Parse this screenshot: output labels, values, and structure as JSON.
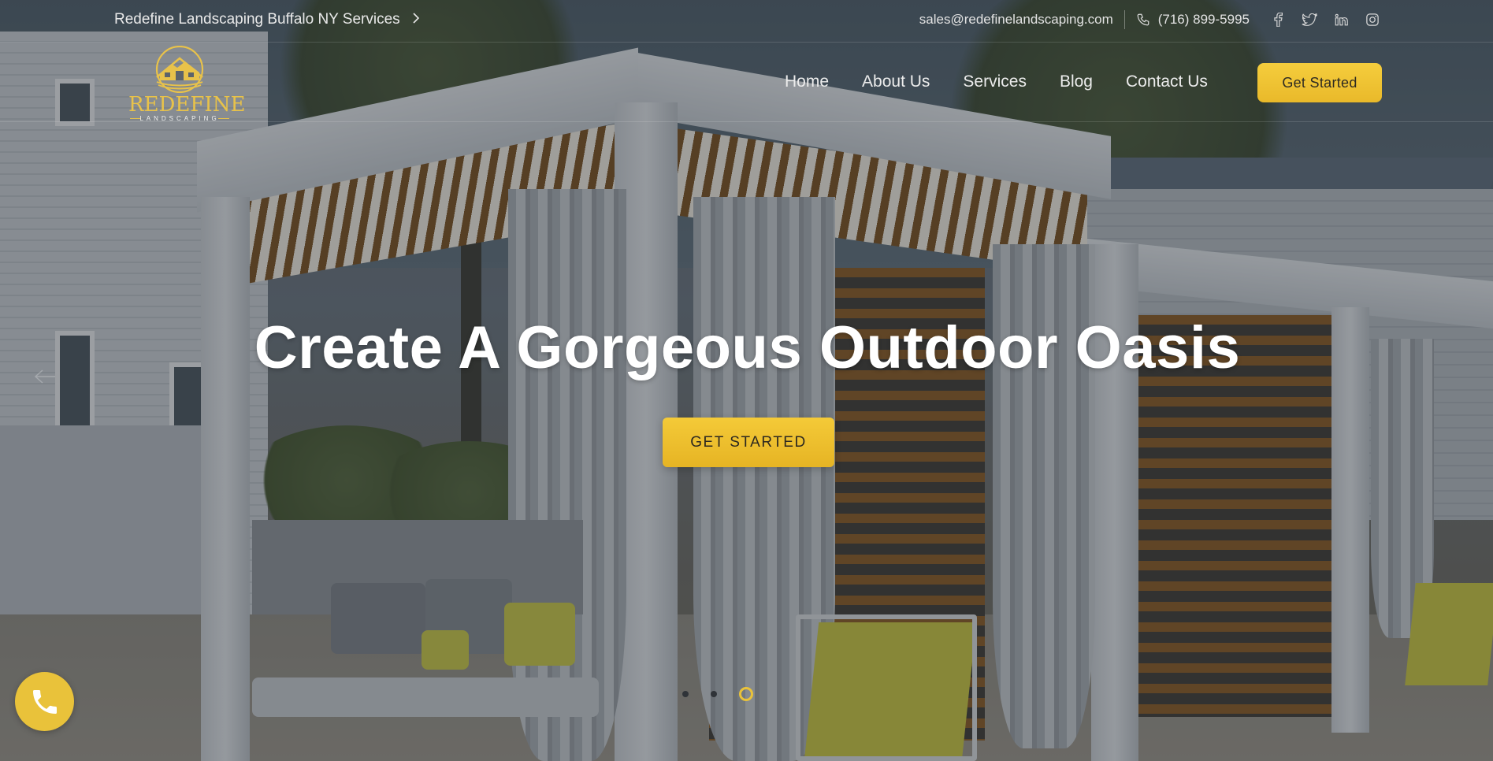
{
  "topbar": {
    "services_link": "Redefine Landscaping Buffalo NY Services",
    "email": "sales@redefinelandscaping.com",
    "phone": "(716) 899-5995",
    "socials": [
      "facebook-icon",
      "twitter-icon",
      "linkedin-icon",
      "instagram-icon"
    ]
  },
  "logo": {
    "name": "REDEFINE",
    "tagline": "LANDSCAPING"
  },
  "nav": {
    "items": [
      {
        "label": "Home"
      },
      {
        "label": "About Us"
      },
      {
        "label": "Services"
      },
      {
        "label": "Blog"
      },
      {
        "label": "Contact Us"
      }
    ],
    "cta_label": "Get Started"
  },
  "hero": {
    "title": "Create A Gorgeous Outdoor Oasis",
    "cta_label": "GET STARTED",
    "slides": {
      "total": 3,
      "active": 3
    }
  },
  "colors": {
    "accent": "#e9c23a",
    "overlay": "#1c242e"
  },
  "icons": {
    "phone": "phone-icon",
    "chevron": "chevron-right-icon",
    "call": "phone-call-icon"
  }
}
